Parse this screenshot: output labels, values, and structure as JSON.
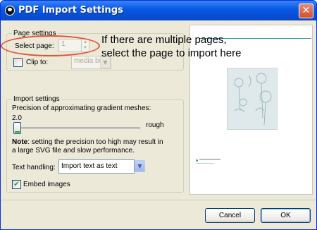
{
  "window": {
    "title": "PDF Import Settings",
    "close_glyph": "✕"
  },
  "page_settings": {
    "legend": "Page settings",
    "select_page_label": "Select page:",
    "select_page_value": "1",
    "clip_to_label": "Clip to:",
    "clip_to_value": "media box",
    "clip_to_checked": false
  },
  "import_settings": {
    "legend": "Import settings",
    "precision_label": "Precision of approximating gradient meshes:",
    "precision_value": "2.0",
    "slider_max_label": "rough",
    "slider_level": 0.0,
    "note_bold": "Note",
    "note_line1": ": setting the precision too high may result in",
    "note_line2": "a large SVG file and slow performance.",
    "text_handling_label": "Text handling:",
    "text_handling_value": "Import text as text",
    "embed_images_label": "Embed images",
    "embed_images_checked": true,
    "check_glyph": "✔"
  },
  "annotation": {
    "line1": "If there are multiple pages,",
    "line2": "select the page to import here",
    "highlight_color": "#e3553a"
  },
  "buttons": {
    "cancel": "Cancel",
    "ok": "OK"
  },
  "icons": {
    "title": "inkscape-logo-icon",
    "close": "close-icon",
    "dropdown": "chevron-down-icon",
    "spin_up": "spin-up-icon",
    "spin_down": "spin-down-icon"
  }
}
